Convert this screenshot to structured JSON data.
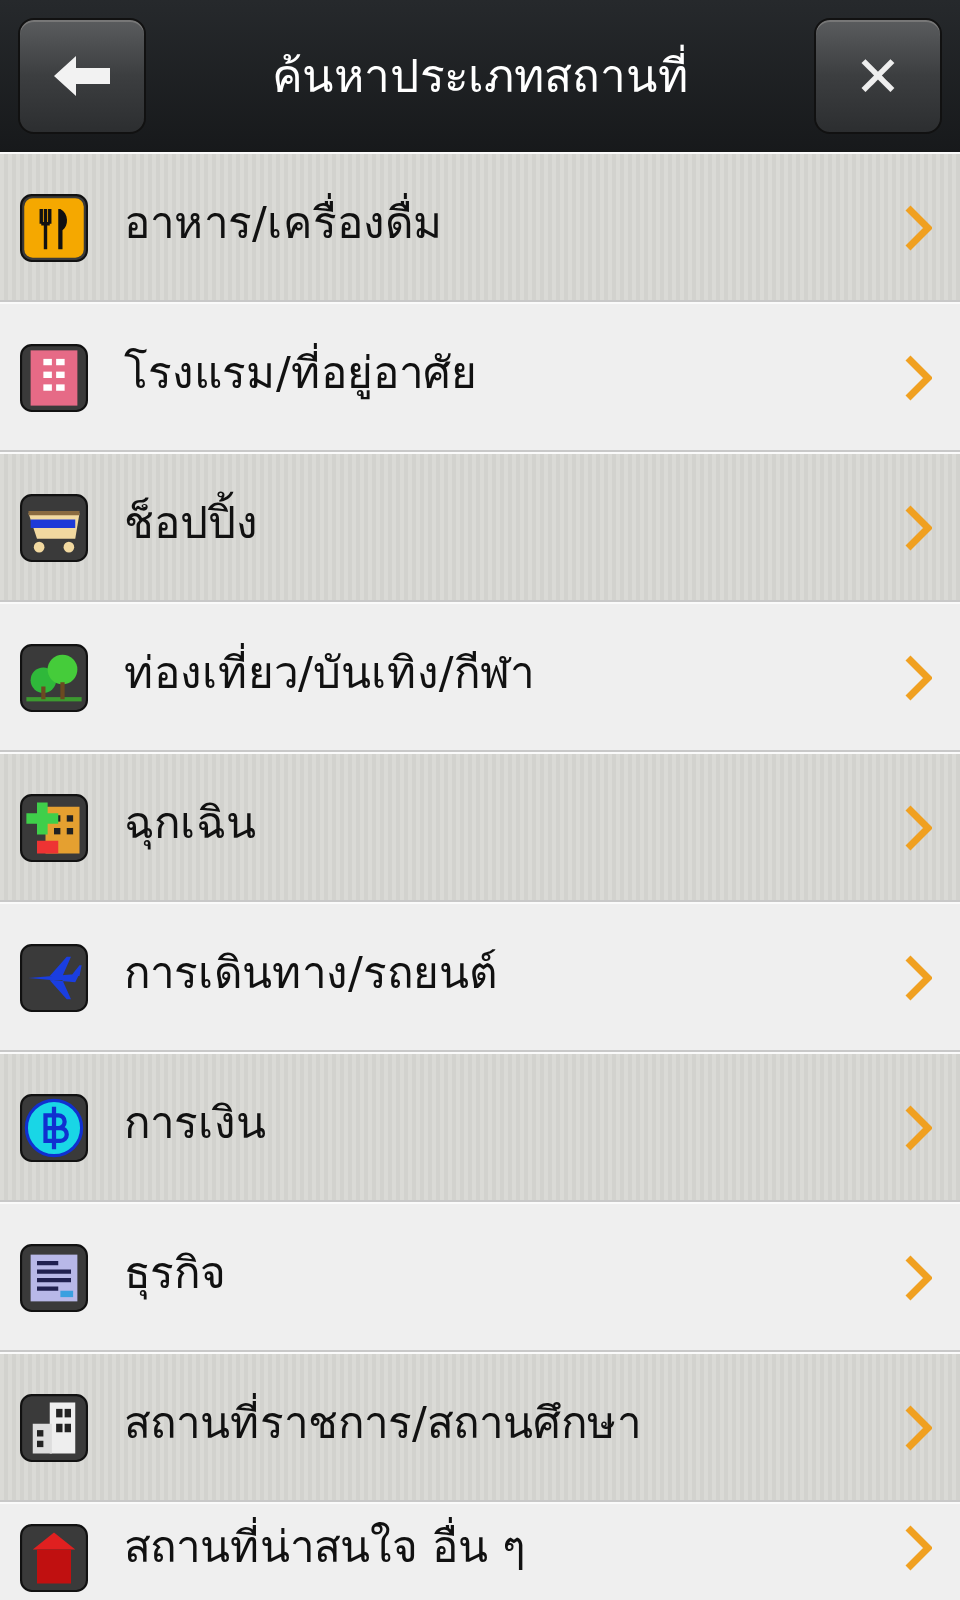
{
  "header": {
    "title": "ค้นหาประเภทสถานที่",
    "close": "✕"
  },
  "categories": [
    {
      "label": "อาหาร/เครื่องดื่ม",
      "kind": "food"
    },
    {
      "label": "โรงแรม/ที่อยู่อาศัย",
      "kind": "hotel"
    },
    {
      "label": "ช็อปปิ้ง",
      "kind": "shopping"
    },
    {
      "label": "ท่องเที่ยว/บันเทิง/กีฬา",
      "kind": "park"
    },
    {
      "label": "ฉุกเฉิน",
      "kind": "emergency"
    },
    {
      "label": "การเดินทาง/รถยนต์",
      "kind": "travel"
    },
    {
      "label": "การเงิน",
      "kind": "finance"
    },
    {
      "label": "ธุรกิจ",
      "kind": "business"
    },
    {
      "label": "สถานที่ราชการ/สถานศึกษา",
      "kind": "government"
    },
    {
      "label": "สถานที่น่าสนใจ อื่น ๆ",
      "kind": "landmark"
    }
  ]
}
